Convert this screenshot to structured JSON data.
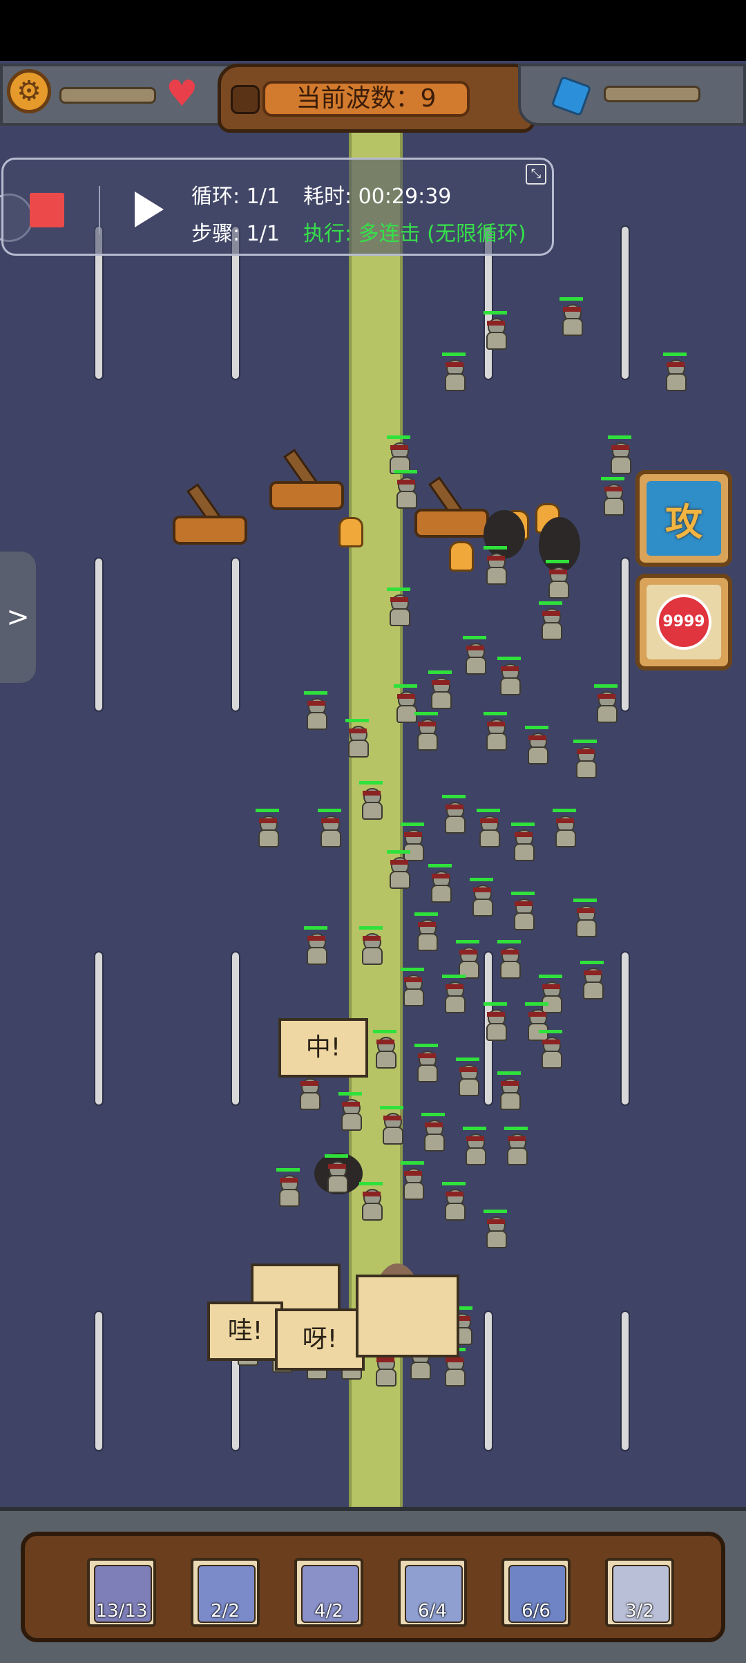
{
  "hud": {
    "wave_label": "当前波数：9",
    "settings_icon": "gear-icon",
    "health_icon": "heart-icon",
    "resource_icon": "blue-cube-icon"
  },
  "macro_overlay": {
    "loop": "循环: 1/1",
    "elapsed": "耗时: 00:29:39",
    "step": "步骤: 1/1",
    "executing": "执行: 多连击 (无限循环)",
    "stop_icon": "stop-icon",
    "play_icon": "play-icon",
    "collapse_icon": "collapse-icon"
  },
  "side_handle": {
    "icon": "chevron-right-icon",
    "label": ">"
  },
  "skills": {
    "attack_label": "攻",
    "target_label": "9999"
  },
  "speech_bubbles": {
    "zhong": "中!",
    "wa": "哇!",
    "ya": "呀!"
  },
  "unit_cards": [
    {
      "name": "hooded-mage",
      "count": "13/13"
    },
    {
      "name": "blonde-shield-hero",
      "count": "2/2"
    },
    {
      "name": "yellow-robed-monk",
      "count": "4/2"
    },
    {
      "name": "bear-warrior",
      "count": "6/4"
    },
    {
      "name": "spartan-helmet",
      "count": "6/6"
    },
    {
      "name": "catapult",
      "count": "3/2"
    }
  ],
  "colors": {
    "field": "#3f4466",
    "median": "#b6c466",
    "hp_bar": "#2fe23b",
    "overlay_green": "#35e04a",
    "stop_red": "#ec4a4a"
  }
}
